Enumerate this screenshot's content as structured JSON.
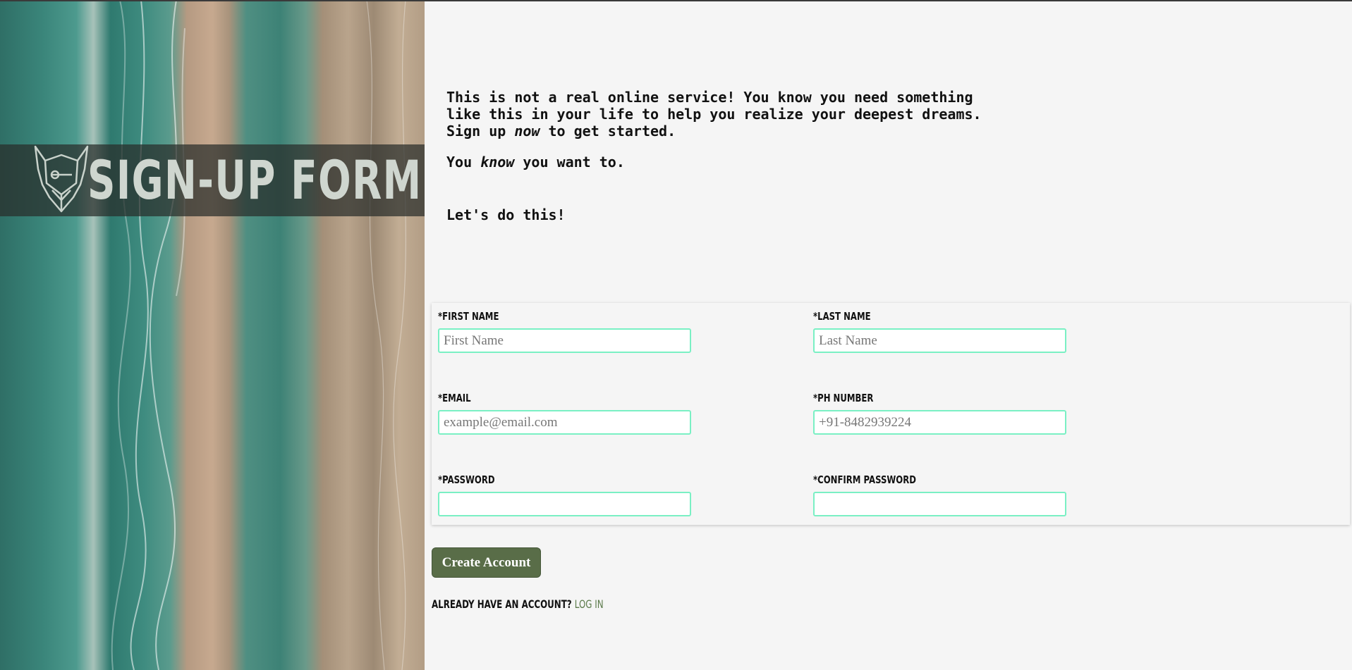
{
  "hero": {
    "title": "SIGN-UP FORM",
    "logo_icon": "viking-helmet-icon"
  },
  "intro": {
    "p1_line1": "This is not a real online service! You know you need something",
    "p1_line2": "like this in your life to help you realize your deepest dreams.",
    "p1_line3_before": "Sign up ",
    "p1_line3_em": "now",
    "p1_line3_after": " to get started.",
    "p2_before": "You ",
    "p2_em": "know",
    "p2_after": " you want to.",
    "p3": "Let's do this!"
  },
  "form": {
    "first_name": {
      "label": "*First Name",
      "placeholder": "First Name",
      "value": ""
    },
    "last_name": {
      "label": "*Last Name",
      "placeholder": "Last Name",
      "value": ""
    },
    "email": {
      "label": "*Email",
      "placeholder": "example@email.com",
      "value": ""
    },
    "phone": {
      "label": "*Ph Number",
      "placeholder": "+91-8482939224",
      "value": ""
    },
    "password": {
      "label": "*Password",
      "placeholder": "",
      "value": ""
    },
    "confirm_password": {
      "label": "*Confirm Password",
      "placeholder": "",
      "value": ""
    }
  },
  "actions": {
    "create_account": "Create Account",
    "login_prompt": "Already have an account? ",
    "login_link": "Log in"
  },
  "colors": {
    "input_border": "#7af0c4",
    "button_bg": "#596d48",
    "link": "#5b7a4a"
  }
}
